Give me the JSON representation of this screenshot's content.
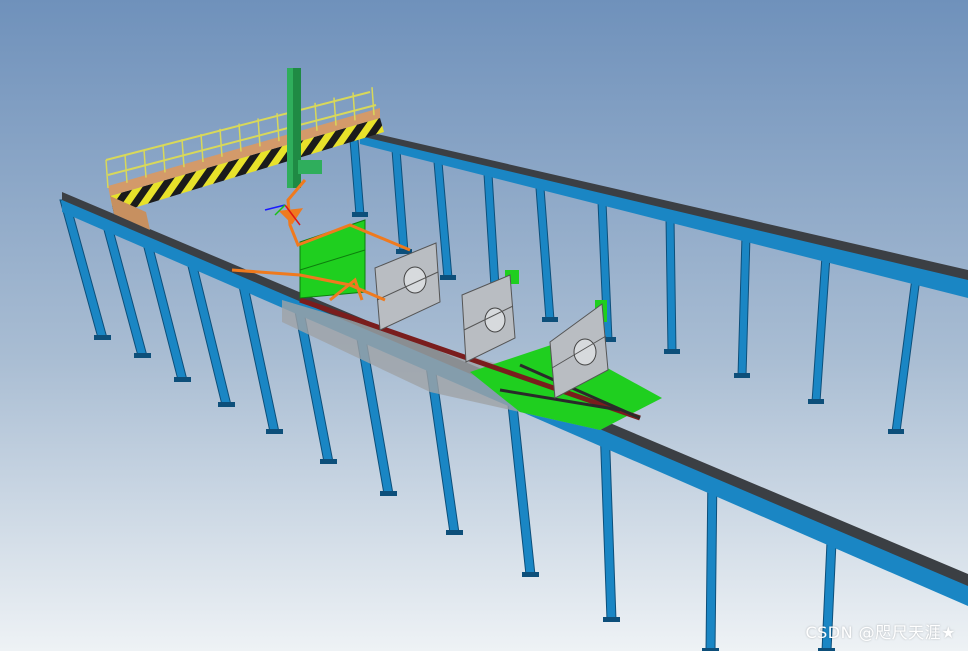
{
  "scene": {
    "description_name": "3d-gantry-welding-cell-view",
    "colors": {
      "sky_top": "#6f91bb",
      "sky_bottom": "#e9eef3",
      "column": "#1a86c4",
      "column_dark": "#0d4f7a",
      "rail": "#3b3f44",
      "beam_yellow": "#e8e22a",
      "hazard_black": "#1b1b1b",
      "guardrail": "#d8d85a",
      "green_plate": "#1fcf1f",
      "gray_panel": "#b9bdc2",
      "orange_arm": "#ef7a1e",
      "mast_green": "#2fae5c",
      "dark_red_bar": "#7a1d1d"
    }
  },
  "watermark": {
    "text": "CSDN @咫尺天涯★"
  }
}
